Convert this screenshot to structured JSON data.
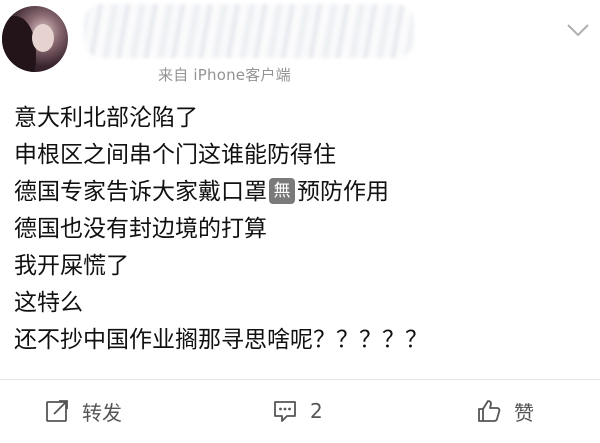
{
  "post": {
    "source": "来自 iPhone客户端",
    "lines": {
      "l1": "意大利北部沦陷了",
      "l2": "申根区之间串个门这谁能防得住",
      "l3a": "德国专家告诉大家戴口罩",
      "l3_emoji": "無",
      "l3b": "预防作用",
      "l4": "德国也没有封边境的打算",
      "l5": "我开屎慌了",
      "l6": "这特么",
      "l7": "还不抄中国作业搁那寻思啥呢？？？？？"
    }
  },
  "actions": {
    "repost_label": "转发",
    "comment_count": "2",
    "like_label": "赞"
  },
  "icons": {
    "repost": "repost-icon",
    "comment": "comment-icon",
    "like": "thumbs-up-icon",
    "more": "chevron-down-icon"
  },
  "colors": {
    "text": "#111111",
    "meta": "#939393",
    "action": "#555555",
    "divider": "#e6e6e6"
  }
}
